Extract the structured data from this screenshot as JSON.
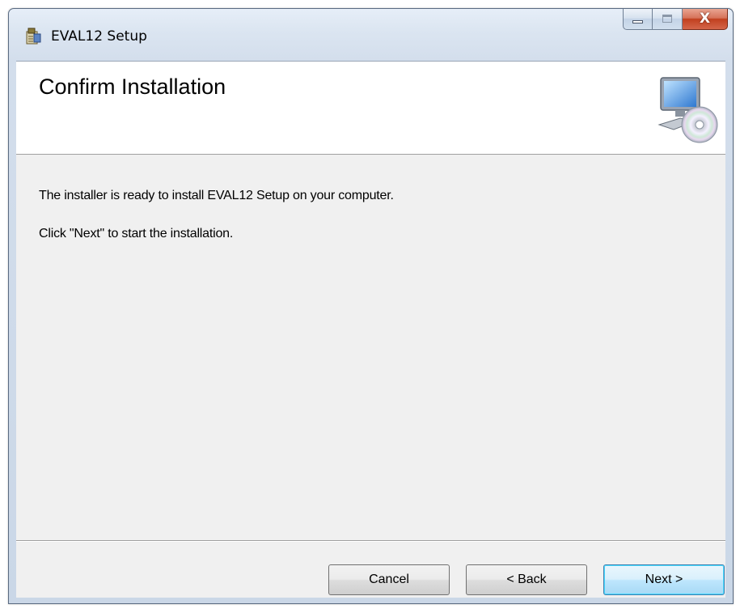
{
  "window": {
    "title": "EVAL12 Setup",
    "icons": {
      "app": "installer-icon",
      "minimize": "minimize-icon",
      "maximize": "maximize-icon",
      "close": "close-icon"
    },
    "close_glyph": "X"
  },
  "header": {
    "title": "Confirm Installation",
    "icon": "computer-cd-icon"
  },
  "body": {
    "line1": "The installer is ready to install EVAL12 Setup on your computer.",
    "line2": "Click \"Next\" to start the installation."
  },
  "buttons": {
    "cancel": "Cancel",
    "back": "< Back",
    "next": "Next >"
  },
  "colors": {
    "close_button": "#c1401f",
    "default_button_border": "#3c7fb1",
    "client_background": "#f0f0f0"
  }
}
